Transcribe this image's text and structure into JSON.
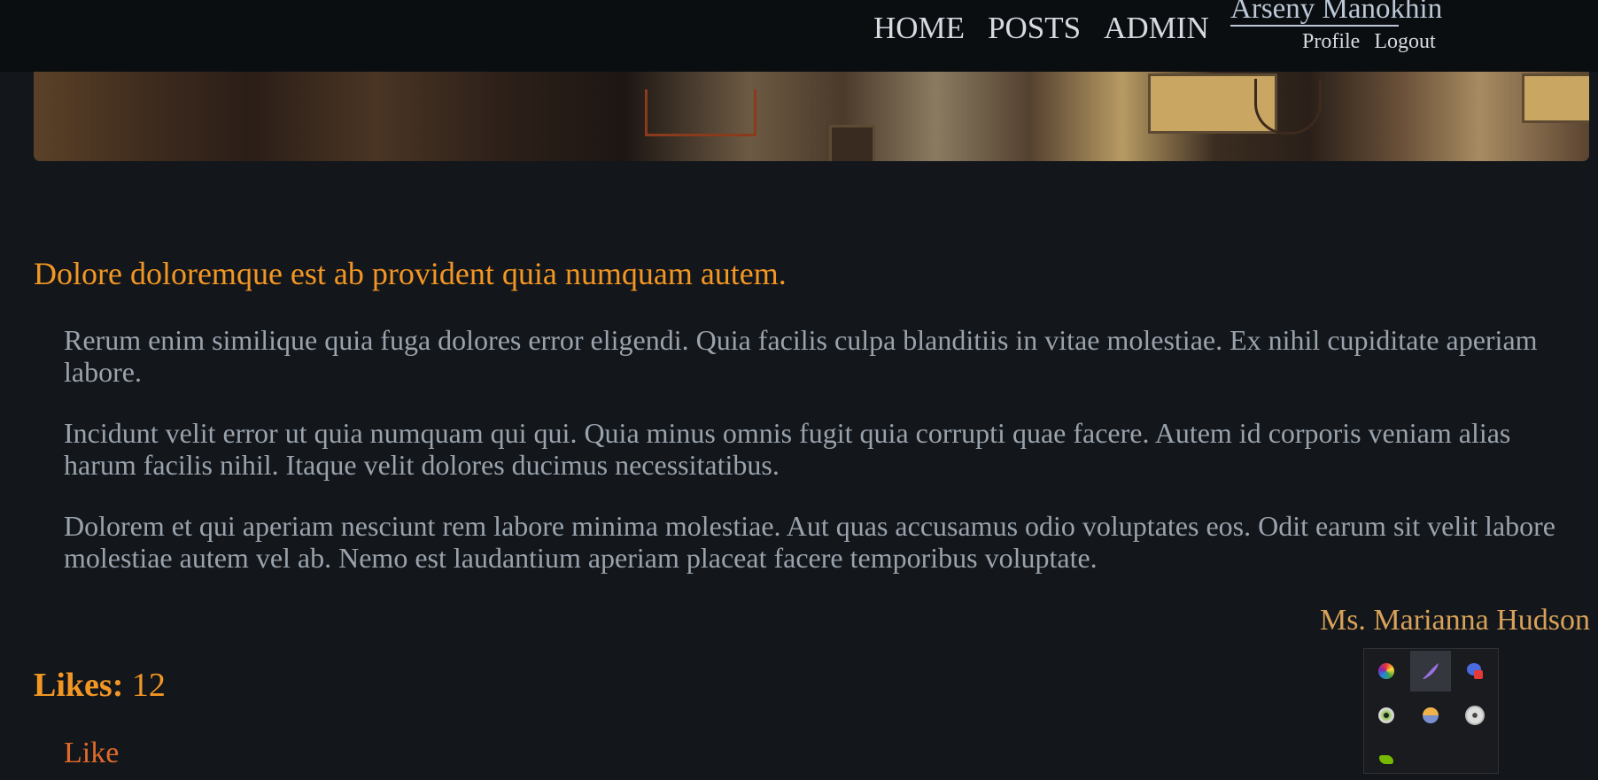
{
  "nav": {
    "items": [
      "HOME",
      "POSTS",
      "ADMIN"
    ]
  },
  "user": {
    "name": "Arseny Manokhin",
    "profile_label": "Profile",
    "logout_label": "Logout"
  },
  "article": {
    "title": "Dolore doloremque est ab provident quia numquam autem.",
    "paragraphs": [
      "Rerum enim similique quia fuga dolores error eligendi. Quia facilis culpa blanditiis in vitae molestiae. Ex nihil cupiditate aperiam labore.",
      "Incidunt velit error ut quia numquam qui qui. Quia minus omnis fugit quia corrupti quae facere. Autem id corporis veniam alias harum facilis nihil. Itaque velit dolores ducimus necessitatibus.",
      "Dolorem et qui aperiam nesciunt rem labore minima molestiae. Aut quas accusamus odio voluptates eos. Odit earum sit velit labore molestiae autem vel ab. Nemo est laudantium aperiam placeat facere temporibus voluptate."
    ],
    "author": "Ms. Marianna Hudson",
    "likes_label": "Likes:",
    "likes_count": "12",
    "like_button": "Like"
  },
  "tray": {
    "icons": [
      "color-wheel-icon",
      "feather-pen-icon",
      "shield-app-icon",
      "disc-icon",
      "half-circle-icon",
      "film-reel-icon",
      "nvidia-icon"
    ]
  },
  "colors": {
    "background": "#13161a",
    "topbar": "#0b0e11",
    "accent": "#f29624",
    "like": "#e06a2b",
    "body_text": "#9aa3ad",
    "author": "#d8a25a"
  }
}
